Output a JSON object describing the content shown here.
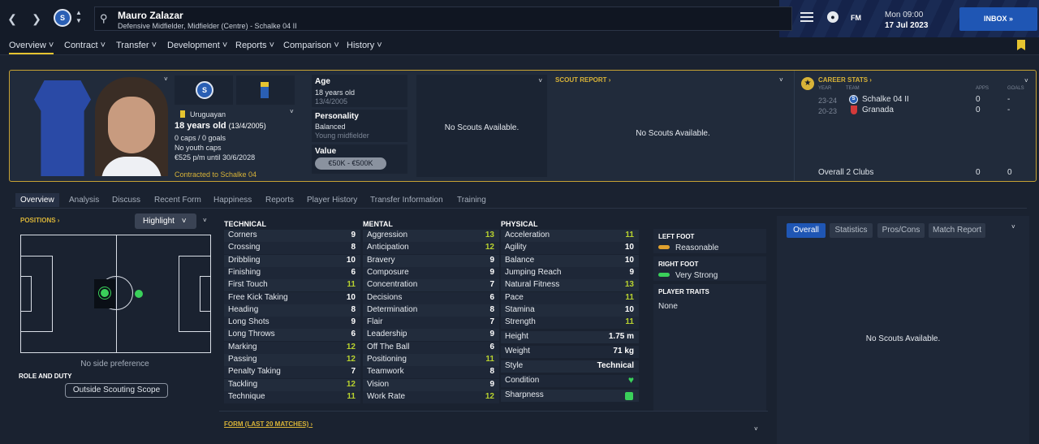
{
  "header": {
    "name": "Mauro Zalazar",
    "position": "Defensive Midfielder, Midfielder (Centre) - Schalke 04 II",
    "day": "Mon 09:00",
    "date": "17 Jul 2023",
    "inbox": "INBOX",
    "fm": "FM"
  },
  "menu": [
    "Overview",
    "Contract",
    "Transfer",
    "Development",
    "Reports",
    "Comparison",
    "History"
  ],
  "profile": {
    "nationality": "Uruguayan",
    "age_line": "18 years old",
    "dob_short": "(13/4/2005)",
    "caps": "0 caps / 0 goals",
    "youth_caps": "No youth caps",
    "wage": "€525 p/m until 30/6/2028",
    "contracted": "Contracted to Schalke 04",
    "age_label": "Age",
    "age_value": "18 years old",
    "age_dob": "13/4/2005",
    "personality_label": "Personality",
    "personality_value": "Balanced",
    "personality_sub": "Young midfielder",
    "value_label": "Value",
    "value_value": "€50K - €500K",
    "no_scouts": "No Scouts Available.",
    "scout_report": "SCOUT REPORT",
    "no_scouts2": "No Scouts Available."
  },
  "career": {
    "title": "CAREER STATS",
    "col_year": "YEAR",
    "col_team": "TEAM",
    "col_apps": "APPS",
    "col_goals": "GOALS",
    "rows": [
      {
        "year": "23-24",
        "team": "Schalke 04 II",
        "apps": "0",
        "goals": "-"
      },
      {
        "year": "20-23",
        "team": "Granada",
        "apps": "0",
        "goals": "-"
      }
    ],
    "total_label": "Overall 2 Clubs",
    "total_apps": "0",
    "total_goals": "0"
  },
  "tabs": [
    "Overview",
    "Analysis",
    "Discuss",
    "Recent Form",
    "Happiness",
    "Reports",
    "Player History",
    "Transfer Information",
    "Training"
  ],
  "positions": {
    "title": "POSITIONS",
    "highlight": "Highlight",
    "side": "No side preference",
    "role_title": "ROLE AND DUTY",
    "scope": "Outside Scouting Scope"
  },
  "technical": {
    "title": "TECHNICAL",
    "items": [
      [
        "Corners",
        "9"
      ],
      [
        "Crossing",
        "8"
      ],
      [
        "Dribbling",
        "10"
      ],
      [
        "Finishing",
        "6"
      ],
      [
        "First Touch",
        "11"
      ],
      [
        "Free Kick Taking",
        "10"
      ],
      [
        "Heading",
        "8"
      ],
      [
        "Long Shots",
        "9"
      ],
      [
        "Long Throws",
        "6"
      ],
      [
        "Marking",
        "12"
      ],
      [
        "Passing",
        "12"
      ],
      [
        "Penalty Taking",
        "7"
      ],
      [
        "Tackling",
        "12"
      ],
      [
        "Technique",
        "11"
      ]
    ]
  },
  "mental": {
    "title": "MENTAL",
    "items": [
      [
        "Aggression",
        "13"
      ],
      [
        "Anticipation",
        "12"
      ],
      [
        "Bravery",
        "9"
      ],
      [
        "Composure",
        "9"
      ],
      [
        "Concentration",
        "7"
      ],
      [
        "Decisions",
        "6"
      ],
      [
        "Determination",
        "8"
      ],
      [
        "Flair",
        "7"
      ],
      [
        "Leadership",
        "9"
      ],
      [
        "Off The Ball",
        "6"
      ],
      [
        "Positioning",
        "11"
      ],
      [
        "Teamwork",
        "8"
      ],
      [
        "Vision",
        "9"
      ],
      [
        "Work Rate",
        "12"
      ]
    ]
  },
  "physical": {
    "title": "PHYSICAL",
    "items": [
      [
        "Acceleration",
        "11"
      ],
      [
        "Agility",
        "10"
      ],
      [
        "Balance",
        "10"
      ],
      [
        "Jumping Reach",
        "9"
      ],
      [
        "Natural Fitness",
        "13"
      ],
      [
        "Pace",
        "11"
      ],
      [
        "Stamina",
        "10"
      ],
      [
        "Strength",
        "11"
      ]
    ],
    "height_label": "Height",
    "height": "1.75 m",
    "weight_label": "Weight",
    "weight": "71 kg",
    "style_label": "Style",
    "style": "Technical",
    "condition_label": "Condition",
    "sharpness_label": "Sharpness"
  },
  "feet": {
    "left_title": "LEFT FOOT",
    "left": "Reasonable",
    "right_title": "RIGHT FOOT",
    "right": "Very Strong",
    "traits_title": "PLAYER TRAITS",
    "traits": "None"
  },
  "right_panel": {
    "tabs": [
      "Overall",
      "Statistics",
      "Pros/Cons",
      "Match Report"
    ],
    "no_scouts": "No Scouts Available."
  },
  "form_title": "FORM (LAST 20 MATCHES)",
  "colors": {
    "accent": "#d8b338",
    "highlight": "#b8d22f",
    "green": "#3ad05a"
  }
}
